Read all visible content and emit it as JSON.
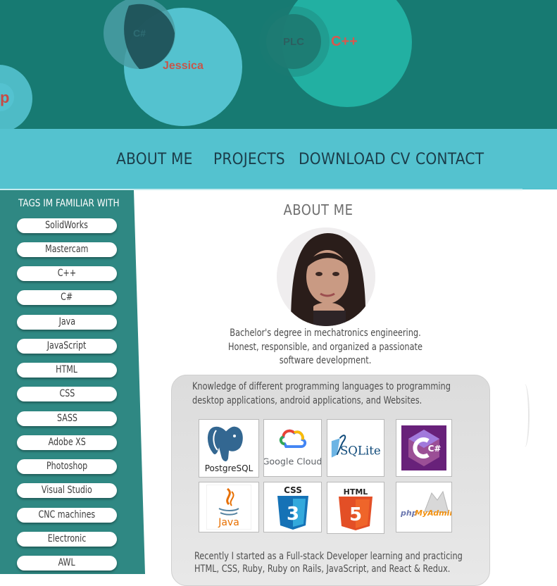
{
  "hero": {
    "words": [
      "C#",
      "Jessica",
      "PLC",
      "C++",
      "p"
    ],
    "bubble_color": "#54c2cf",
    "bubble_alt_color": "#22b0a2",
    "background": "#177a72"
  },
  "nav": {
    "items": [
      "ABOUT ME",
      "PROJECTS",
      "DOWNLOAD CV",
      "CONTACT"
    ]
  },
  "sidebar": {
    "title": "TAGS IM FAMILIAR WITH",
    "tags": [
      "SolidWorks",
      "Mastercam",
      "C++",
      "C#",
      "Java",
      "JavaScript",
      "HTML",
      "CSS",
      "SASS",
      "Adobe XS",
      "Photoshop",
      "Visual Studio",
      "CNC machines",
      "Electronic",
      "AWL"
    ]
  },
  "about": {
    "title": "ABOUT ME",
    "bio_lines": [
      "Bachelor's degree in mechatronics engineering.",
      "Honest, responsible, and organized a passionate",
      "software development."
    ],
    "card_lines": [
      "Knowledge of different programming languages to programming",
      "desktop applications, android applications, and Websites."
    ],
    "footer_lines": [
      "Recently I started as a Full-stack Developer learning and practicing",
      "HTML, CSS, Ruby, Ruby on Rails, JavaScript, and React & Redux."
    ]
  },
  "logos": {
    "postgres": "PostgreSQL",
    "gcloud": "Google Cloud",
    "sqlite": "SQLite",
    "csharp": "C#",
    "java": "Java",
    "css": "CSS",
    "css_num": "3",
    "html": "HTML",
    "html_num": "5",
    "phpmyadmin_php": "php",
    "phpmyadmin_admin": "MyAdmin"
  }
}
